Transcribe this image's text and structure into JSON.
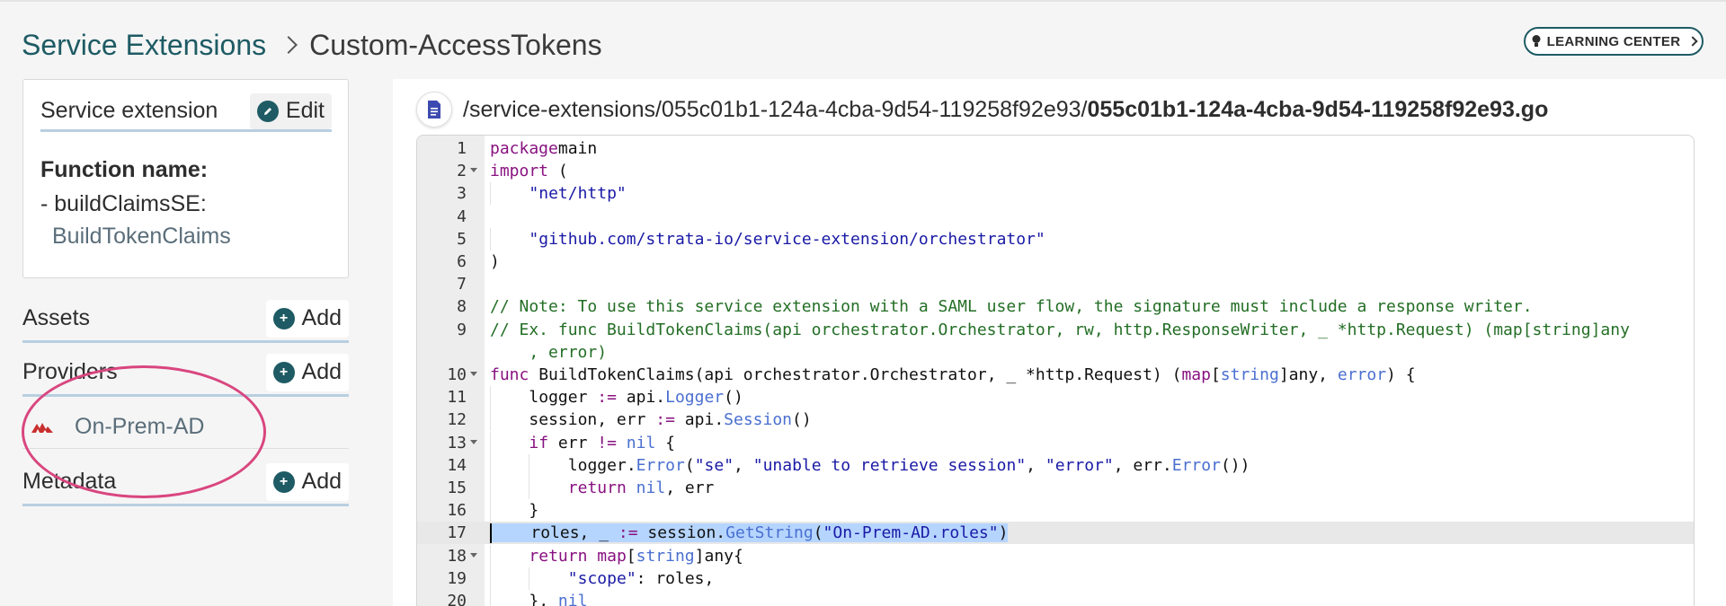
{
  "breadcrumb": {
    "parent": "Service Extensions",
    "current": "Custom-AccessTokens"
  },
  "learning_center": {
    "label": "LEARNING CENTER"
  },
  "sidebar": {
    "card": {
      "title": "Service extension",
      "edit_label": "Edit",
      "function_label": "Function name:",
      "function_item": "- buildClaimsSE:",
      "function_value": "BuildTokenClaims"
    },
    "sections": [
      {
        "label": "Assets",
        "add_label": "Add"
      },
      {
        "label": "Providers",
        "add_label": "Add"
      },
      {
        "label": "Metadata",
        "add_label": "Add"
      }
    ],
    "providers": [
      {
        "name": "On-Prem-AD"
      }
    ]
  },
  "editor": {
    "path_prefix": "/service-extensions/055c01b1-124a-4cba-9d54-119258f92e93/",
    "file_name": "055c01b1-124a-4cba-9d54-119258f92e93.go",
    "lines": [
      {
        "n": "1",
        "fold": false,
        "tokens": [
          [
            "k",
            "package"
          ],
          [
            "",
            "main"
          ]
        ]
      },
      {
        "n": "2",
        "fold": true,
        "tokens": [
          [
            "k",
            "import"
          ],
          [
            "",
            " ("
          ]
        ]
      },
      {
        "n": "3",
        "fold": false,
        "indent": 1,
        "tokens": [
          [
            "s",
            "\"net/http\""
          ]
        ]
      },
      {
        "n": "4",
        "fold": false,
        "tokens": []
      },
      {
        "n": "5",
        "fold": false,
        "indent": 1,
        "tokens": [
          [
            "s",
            "\"github.com/strata-io/service-extension/orchestrator\""
          ]
        ]
      },
      {
        "n": "6",
        "fold": false,
        "tokens": [
          [
            "",
            ")"
          ]
        ]
      },
      {
        "n": "7",
        "fold": false,
        "tokens": []
      },
      {
        "n": "8",
        "fold": false,
        "tokens": [
          [
            "c",
            "// Note: To use this service extension with a SAML user flow, the signature must include a response writer."
          ]
        ]
      },
      {
        "n": "9",
        "fold": false,
        "tokens": [
          [
            "c",
            "// Ex. func BuildTokenClaims(api orchestrator.Orchestrator, rw, http.ResponseWriter, _ *http.Request) (map[string]any"
          ]
        ]
      },
      {
        "n": "",
        "fold": false,
        "tokens": [
          [
            "c",
            "    , error)"
          ]
        ]
      },
      {
        "n": "10",
        "fold": true,
        "tokens": [
          [
            "k",
            "func"
          ],
          [
            "",
            " BuildTokenClaims(api orchestrator.Orchestrator, _ *http.Request) ("
          ],
          [
            "k",
            "map"
          ],
          [
            "",
            "["
          ],
          [
            "t",
            "string"
          ],
          [
            "",
            "]any, "
          ],
          [
            "t",
            "error"
          ],
          [
            "",
            ") {"
          ]
        ]
      },
      {
        "n": "11",
        "fold": false,
        "indent": 1,
        "tokens": [
          [
            "",
            "logger "
          ],
          [
            "k",
            ":="
          ],
          [
            "",
            " api."
          ],
          [
            "t",
            "Logger"
          ],
          [
            "",
            "()"
          ]
        ]
      },
      {
        "n": "12",
        "fold": false,
        "indent": 1,
        "tokens": [
          [
            "",
            "session, err "
          ],
          [
            "k",
            ":="
          ],
          [
            "",
            " api."
          ],
          [
            "t",
            "Session"
          ],
          [
            "",
            "()"
          ]
        ]
      },
      {
        "n": "13",
        "fold": true,
        "indent": 1,
        "tokens": [
          [
            "k",
            "if"
          ],
          [
            "",
            " err "
          ],
          [
            "k",
            "!="
          ],
          [
            "",
            " "
          ],
          [
            "t",
            "nil"
          ],
          [
            "",
            " {"
          ]
        ]
      },
      {
        "n": "14",
        "fold": false,
        "indent": 2,
        "tokens": [
          [
            "",
            "logger."
          ],
          [
            "t",
            "Error"
          ],
          [
            "",
            "("
          ],
          [
            "s",
            "\"se\""
          ],
          [
            "",
            ", "
          ],
          [
            "s",
            "\"unable to retrieve session\""
          ],
          [
            "",
            ", "
          ],
          [
            "s",
            "\"error\""
          ],
          [
            "",
            ", err."
          ],
          [
            "t",
            "Error"
          ],
          [
            "",
            "())"
          ]
        ]
      },
      {
        "n": "15",
        "fold": false,
        "indent": 2,
        "tokens": [
          [
            "k",
            "return"
          ],
          [
            "",
            " "
          ],
          [
            "t",
            "nil"
          ],
          [
            "",
            ", err"
          ]
        ]
      },
      {
        "n": "16",
        "fold": false,
        "indent": 1,
        "tokens": [
          [
            "",
            "}"
          ]
        ]
      },
      {
        "n": "17",
        "fold": false,
        "indent": 1,
        "active": true,
        "tokens": [
          [
            "",
            "roles, _ "
          ],
          [
            "k",
            ":="
          ],
          [
            "",
            " session."
          ],
          [
            "t",
            "GetString"
          ],
          [
            "",
            "("
          ],
          [
            "s",
            "\"On-Prem-AD.roles\""
          ],
          [
            "",
            ")"
          ]
        ]
      },
      {
        "n": "18",
        "fold": true,
        "indent": 1,
        "tokens": [
          [
            "k",
            "return"
          ],
          [
            "",
            " "
          ],
          [
            "k",
            "map"
          ],
          [
            "",
            "["
          ],
          [
            "t",
            "string"
          ],
          [
            "",
            "]any{"
          ]
        ]
      },
      {
        "n": "19",
        "fold": false,
        "indent": 2,
        "tokens": [
          [
            "s",
            "\"scope\""
          ],
          [
            "",
            ": roles,"
          ]
        ]
      },
      {
        "n": "20",
        "fold": false,
        "indent": 1,
        "tokens": [
          [
            "",
            "}, "
          ],
          [
            "t",
            "nil"
          ]
        ]
      }
    ]
  },
  "colors": {
    "brand": "#1e5b64",
    "annotation": "#d9467f",
    "selection": "#b5d5ff"
  }
}
